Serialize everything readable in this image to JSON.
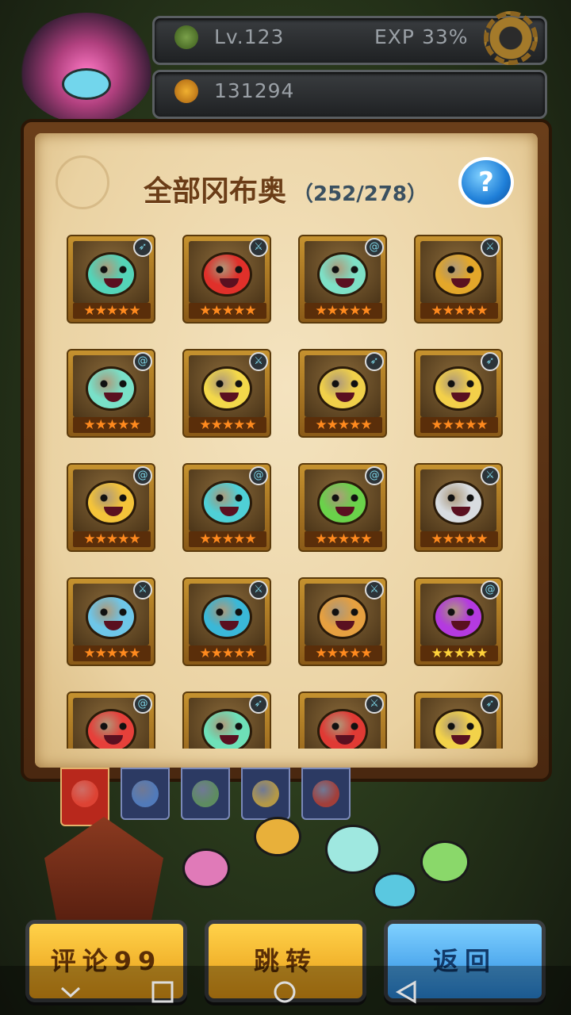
{
  "hud": {
    "level": "Lv.123",
    "exp": "EXP 33%",
    "currency": "131294"
  },
  "collection": {
    "title": "全部冈布奥",
    "count": "（252/278）",
    "monsters": [
      {
        "color": "#54d4b8",
        "badge": "arrow-icon",
        "stars": "★★★★★",
        "gold": false
      },
      {
        "color": "#e0302a",
        "badge": "sword-icon",
        "stars": "★★★★★",
        "gold": false
      },
      {
        "color": "#7ee0c6",
        "badge": "spiral-icon",
        "stars": "★★★★★",
        "gold": false
      },
      {
        "color": "#e3a72a",
        "badge": "sword-icon",
        "stars": "★★★★★",
        "gold": false
      },
      {
        "color": "#79e0c8",
        "badge": "spiral-icon",
        "stars": "★★★★★",
        "gold": false
      },
      {
        "color": "#f3d84a",
        "badge": "sword-icon",
        "stars": "★★★★★",
        "gold": false
      },
      {
        "color": "#f0d04a",
        "badge": "arrow-icon",
        "stars": "★★★★★",
        "gold": false
      },
      {
        "color": "#f3d04a",
        "badge": "arrow-icon",
        "stars": "★★★★★",
        "gold": false
      },
      {
        "color": "#f4c43a",
        "badge": "spiral-icon",
        "stars": "★★★★★",
        "gold": false
      },
      {
        "color": "#4fd0d6",
        "badge": "spiral-icon",
        "stars": "★★★★★",
        "gold": false
      },
      {
        "color": "#6ad24a",
        "badge": "spiral-icon",
        "stars": "★★★★★",
        "gold": false
      },
      {
        "color": "#d8dce0",
        "badge": "sword-icon",
        "stars": "★★★★★",
        "gold": false
      },
      {
        "color": "#6ec6e8",
        "badge": "sword-icon",
        "stars": "★★★★★",
        "gold": false
      },
      {
        "color": "#3ab8d8",
        "badge": "sword-icon",
        "stars": "★★★★★",
        "gold": false
      },
      {
        "color": "#e6a040",
        "badge": "sword-icon",
        "stars": "★★★★★",
        "gold": false
      },
      {
        "color": "#b43ae0",
        "badge": "spiral-icon",
        "stars": "★★★★★",
        "gold": true
      },
      {
        "color": "#e6403a",
        "badge": "spiral-icon",
        "stars": "★★★★★",
        "gold": false
      },
      {
        "color": "#6ee0b8",
        "badge": "arrow-icon",
        "stars": "★★★★★",
        "gold": false
      },
      {
        "color": "#e03a34",
        "badge": "sword-icon",
        "stars": "★★★★★",
        "gold": false
      },
      {
        "color": "#f2d24a",
        "badge": "arrow-icon",
        "stars": "★★★★★",
        "gold": false
      }
    ]
  },
  "tabs": [
    {
      "name": "tab-all",
      "color": "#e64a3a"
    },
    {
      "name": "tab-blue",
      "color": "#5a8ad0"
    },
    {
      "name": "tab-green",
      "color": "#6aa060"
    },
    {
      "name": "tab-yellow",
      "color": "#d6b040"
    },
    {
      "name": "tab-red",
      "color": "#c04030"
    }
  ],
  "buttons": {
    "comment": "评论99",
    "jump": "跳转",
    "back": "返回"
  },
  "icons": {
    "help": "?"
  }
}
